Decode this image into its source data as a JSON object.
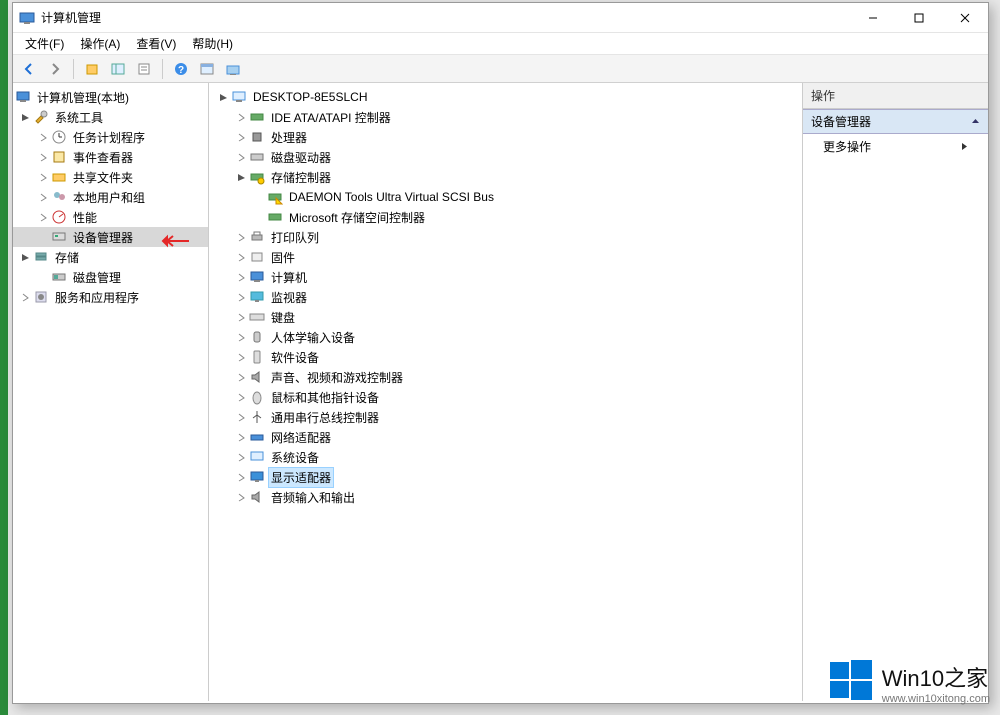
{
  "window": {
    "title": "计算机管理"
  },
  "menu": {
    "file": "文件(F)",
    "action": "操作(A)",
    "view": "查看(V)",
    "help": "帮助(H)"
  },
  "left_tree": {
    "root": "计算机管理(本地)",
    "system_tools": "系统工具",
    "task_scheduler": "任务计划程序",
    "event_viewer": "事件查看器",
    "shared_folders": "共享文件夹",
    "local_users": "本地用户和组",
    "performance": "性能",
    "device_manager": "设备管理器",
    "storage": "存储",
    "disk_management": "磁盘管理",
    "services": "服务和应用程序"
  },
  "mid_tree": {
    "root": "DESKTOP-8E5SLCH",
    "ide": "IDE ATA/ATAPI 控制器",
    "cpu": "处理器",
    "disk_drives": "磁盘驱动器",
    "storage_controllers": "存储控制器",
    "daemon": "DAEMON Tools Ultra Virtual SCSI Bus",
    "ms_storage": "Microsoft 存储空间控制器",
    "print_queues": "打印队列",
    "firmware": "固件",
    "computer": "计算机",
    "monitors": "监视器",
    "keyboards": "键盘",
    "hid": "人体学输入设备",
    "software_devices": "软件设备",
    "sound": "声音、视频和游戏控制器",
    "mice": "鼠标和其他指针设备",
    "usb": "通用串行总线控制器",
    "network": "网络适配器",
    "system_devices": "系统设备",
    "display": "显示适配器",
    "audio_io": "音频输入和输出"
  },
  "actions": {
    "header": "操作",
    "section": "设备管理器",
    "more": "更多操作"
  },
  "watermark": {
    "title": "Win10之家",
    "url": "www.win10xitong.com"
  }
}
